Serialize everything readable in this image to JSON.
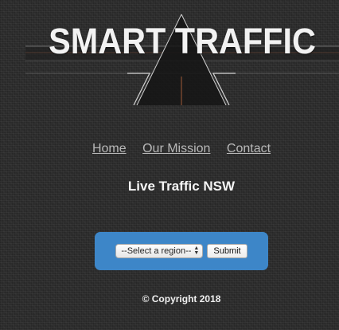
{
  "banner": {
    "title": "SMART TRAFFIC"
  },
  "nav": {
    "items": [
      {
        "label": "Home"
      },
      {
        "label": "Our Mission"
      },
      {
        "label": "Contact"
      }
    ]
  },
  "subtitle": "Live Traffic NSW",
  "form": {
    "select_value": "--Select a region--",
    "submit_label": "Submit"
  },
  "footer": {
    "copyright": "© Copyright 2018"
  },
  "colors": {
    "background": "#2c2c2c",
    "form_box": "#3d86c8",
    "nav_link": "#b8b8b8"
  },
  "icons": {
    "select_arrows": "select-arrows-icon"
  }
}
